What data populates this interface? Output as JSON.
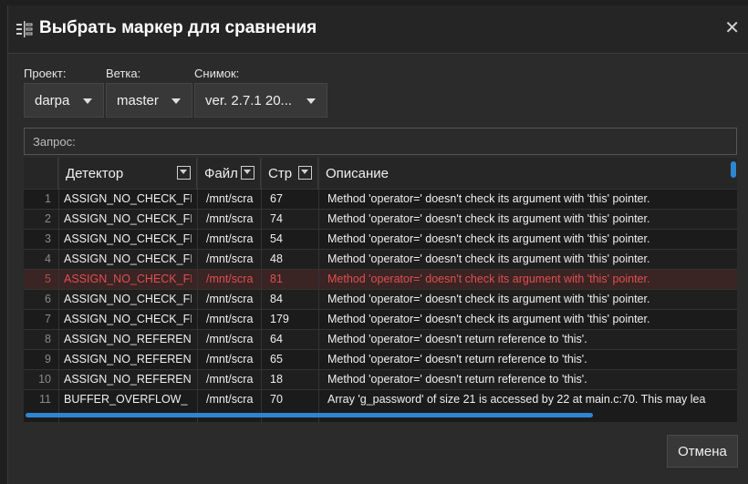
{
  "dialog": {
    "title": "Выбрать маркер для сравнения",
    "close": "✕",
    "cancel": "Отмена"
  },
  "filters": {
    "project_label": "Проект:",
    "project_value": "darpa",
    "branch_label": "Ветка:",
    "branch_value": "master",
    "snapshot_label": "Снимок:",
    "snapshot_value": "ver. 2.7.1 20..."
  },
  "query": {
    "placeholder": "Запрос:"
  },
  "table": {
    "columns": [
      "Детектор",
      "Файл",
      "Стр",
      "Описание"
    ],
    "rows": [
      {
        "n": "1",
        "detector": "ASSIGN_NO_CHECK_FI",
        "file": "/mnt/scra",
        "line": "67",
        "desc": "Method 'operator=' doesn't check its argument with 'this' pointer."
      },
      {
        "n": "2",
        "detector": "ASSIGN_NO_CHECK_FI",
        "file": "/mnt/scra",
        "line": "74",
        "desc": "Method 'operator=' doesn't check its argument with 'this' pointer."
      },
      {
        "n": "3",
        "detector": "ASSIGN_NO_CHECK_FI",
        "file": "/mnt/scra",
        "line": "54",
        "desc": "Method 'operator=' doesn't check its argument with 'this' pointer."
      },
      {
        "n": "4",
        "detector": "ASSIGN_NO_CHECK_FI",
        "file": "/mnt/scra",
        "line": "48",
        "desc": "Method 'operator=' doesn't check its argument with 'this' pointer."
      },
      {
        "n": "5",
        "detector": "ASSIGN_NO_CHECK_FI",
        "file": "/mnt/scra",
        "line": "81",
        "desc": "Method 'operator=' doesn't check its argument with 'this' pointer."
      },
      {
        "n": "6",
        "detector": "ASSIGN_NO_CHECK_FI",
        "file": "/mnt/scra",
        "line": "84",
        "desc": "Method 'operator=' doesn't check its argument with 'this' pointer."
      },
      {
        "n": "7",
        "detector": "ASSIGN_NO_CHECK_FI",
        "file": "/mnt/scra",
        "line": "179",
        "desc": "Method 'operator=' doesn't check its argument with 'this' pointer."
      },
      {
        "n": "8",
        "detector": "ASSIGN_NO_REFEREN",
        "file": "/mnt/scra",
        "line": "64",
        "desc": "Method 'operator=' doesn't return reference to 'this'."
      },
      {
        "n": "9",
        "detector": "ASSIGN_NO_REFEREN",
        "file": "/mnt/scra",
        "line": "65",
        "desc": "Method 'operator=' doesn't return reference to 'this'."
      },
      {
        "n": "10",
        "detector": "ASSIGN_NO_REFEREN",
        "file": "/mnt/scra",
        "line": "18",
        "desc": "Method 'operator=' doesn't return reference to 'this'."
      },
      {
        "n": "11",
        "detector": "BUFFER_OVERFLOW_",
        "file": "/mnt/scra",
        "line": "70",
        "desc": "Array 'g_password' of size 21 is accessed by 22 at main.c:70. This may lea"
      }
    ]
  }
}
